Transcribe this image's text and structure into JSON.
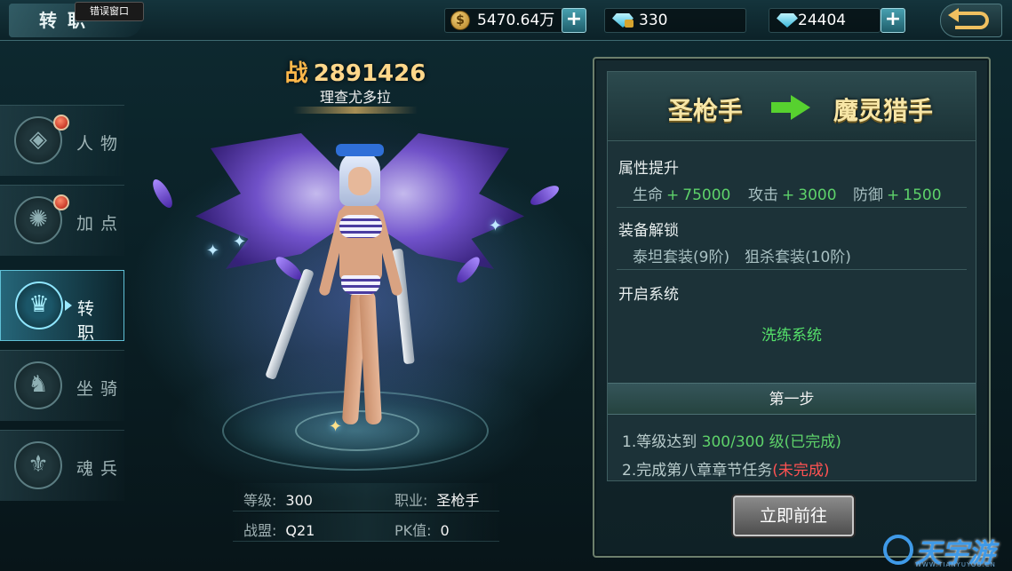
{
  "header": {
    "title": "转职",
    "error_window": "错误窗口",
    "gold": "5470.64万",
    "bound_diamond": "330",
    "diamond": "24404",
    "plus_symbol": "+"
  },
  "sidebar": {
    "items": [
      {
        "label": "人物",
        "icon": "character-emblem-icon",
        "has_alert": true,
        "active": false
      },
      {
        "label": "加点",
        "icon": "attribute-emblem-icon",
        "has_alert": true,
        "active": false
      },
      {
        "label": "转职",
        "icon": "class-change-emblem-icon",
        "has_alert": false,
        "active": true
      },
      {
        "label": "坐骑",
        "icon": "mount-emblem-icon",
        "has_alert": false,
        "active": false
      },
      {
        "label": "魂兵",
        "icon": "soul-weapon-emblem-icon",
        "has_alert": false,
        "active": false
      }
    ]
  },
  "character": {
    "power_label": "战",
    "power_value": "2891426",
    "name": "理查尤多拉",
    "stats": {
      "level_label": "等级:",
      "level_value": "300",
      "class_label": "职业:",
      "class_value": "圣枪手",
      "guild_label": "战盟:",
      "guild_value": "Q21",
      "pk_label": "PK值:",
      "pk_value": "0"
    }
  },
  "panel": {
    "from_class": "圣枪手",
    "to_class": "魔灵猎手",
    "attr_title": "属性提升",
    "attrs": [
      {
        "name": "生命",
        "plus": "+",
        "value": "75000"
      },
      {
        "name": "攻击",
        "plus": "+",
        "value": "3000"
      },
      {
        "name": "防御",
        "plus": "+",
        "value": "1500"
      }
    ],
    "equip_title": "装备解锁",
    "equips": [
      "泰坦套装(9阶)",
      "狙杀套装(10阶)"
    ],
    "system_title": "开启系统",
    "system_value": "洗练系统",
    "step_title": "第一步",
    "req1_prefix": "1.等级达到",
    "req1_value": "300/300",
    "req1_unit": "级",
    "req1_status": "(已完成)",
    "req2_text": "2.完成第八章章节任务",
    "req2_status": "(未完成)",
    "go_button": "立即前往"
  },
  "watermark": {
    "brand": "天宇游",
    "url": "WWW.TIANYUYOU.CN"
  },
  "colors": {
    "accent_gold": "#ffd78a",
    "green": "#5ed26a",
    "red": "#ff5252",
    "class_text": "#f7e6a6"
  }
}
